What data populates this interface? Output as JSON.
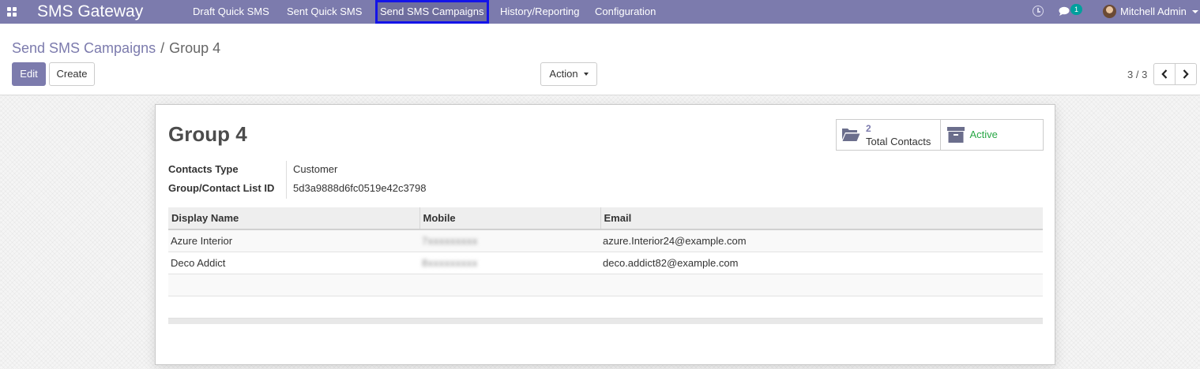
{
  "app": {
    "title": "SMS Gateway",
    "menu": [
      {
        "label": "Draft Quick SMS"
      },
      {
        "label": "Sent Quick SMS"
      },
      {
        "label": "Send SMS Campaigns",
        "active": true
      },
      {
        "label": "History/Reporting"
      },
      {
        "label": "Configuration"
      }
    ],
    "chat_badge": "1",
    "user": {
      "name": "Mitchell Admin"
    }
  },
  "breadcrumb": {
    "parent": "Send SMS Campaigns",
    "separator": "/",
    "current": "Group 4"
  },
  "toolbar": {
    "edit_label": "Edit",
    "create_label": "Create",
    "action_label": "Action",
    "pager": "3 / 3"
  },
  "record": {
    "title": "Group 4",
    "stats": {
      "total_contacts_count": "2",
      "total_contacts_label": "Total Contacts",
      "active_label": "Active"
    },
    "fields": [
      {
        "label": "Contacts Type",
        "value": "Customer"
      },
      {
        "label": "Group/Contact List ID",
        "value": "5d3a9888d6fc0519e42c3798"
      }
    ],
    "contacts_table": {
      "columns": [
        "Display Name",
        "Mobile",
        "Email"
      ],
      "rows": [
        {
          "name": "Azure Interior",
          "mobile": "7xxxxxxxxx",
          "email": "azure.Interior24@example.com"
        },
        {
          "name": "Deco Addict",
          "mobile": "8xxxxxxxxx",
          "email": "deco.addict82@example.com"
        }
      ]
    }
  },
  "colors": {
    "navbar": "#7c7bad",
    "primary": "#7c7bad",
    "active_status": "#28a745",
    "highlight_outline": "#1414e8"
  }
}
